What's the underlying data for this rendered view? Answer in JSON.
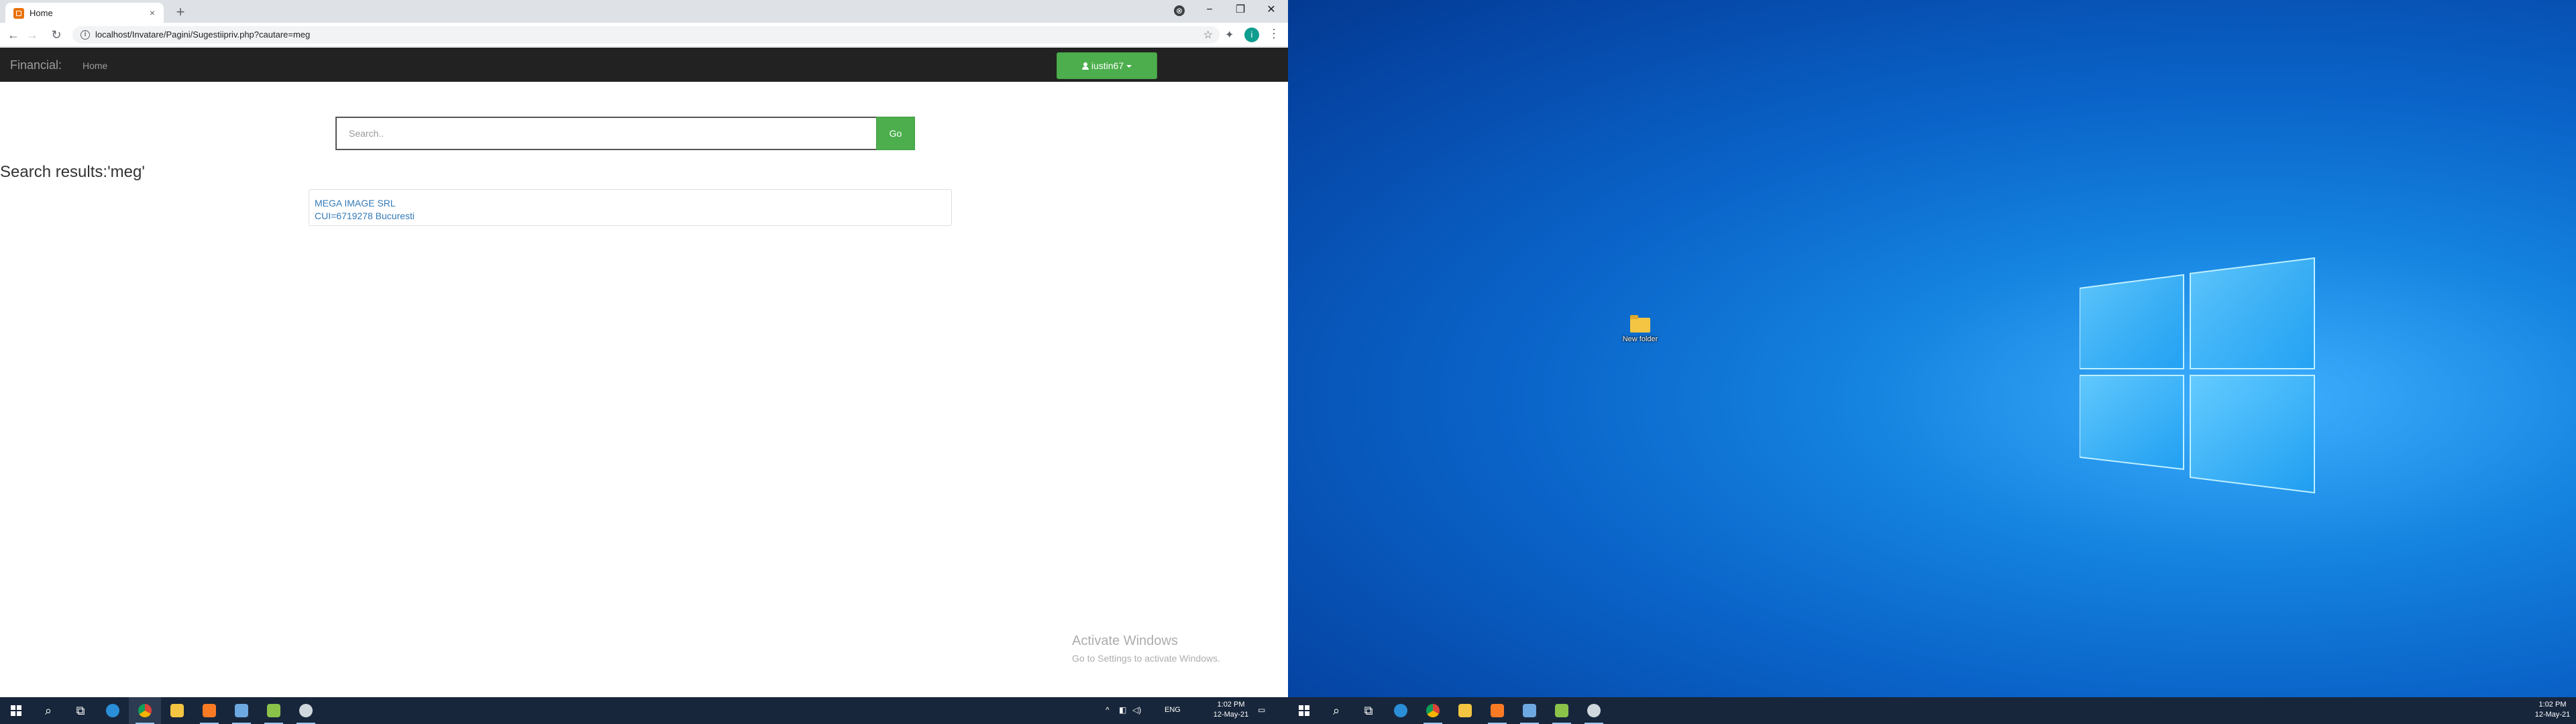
{
  "browser": {
    "tab_title": "Home",
    "tab_close": "×",
    "new_tab": "+",
    "url": "localhost/Invatare/Pagini/Sugestiipriv.php?cautare=meg",
    "window_controls": {
      "minimize": "−",
      "maximize": "❐",
      "close": "✕"
    },
    "profile_initial": "i"
  },
  "navbar": {
    "brand": "Financial:",
    "home": "Home",
    "user_label": "iustin67"
  },
  "search": {
    "placeholder": "Search..",
    "button": "Go"
  },
  "results": {
    "title": "Search results:'meg'",
    "items": [
      {
        "name": "MEGA IMAGE SRL",
        "info": "CUI=6719278 Bucuresti"
      }
    ]
  },
  "watermark": {
    "line1": "Activate Windows",
    "line2": "Go to Settings to activate Windows."
  },
  "taskbar_left": {
    "language": "ENG",
    "time": "1:02 PM",
    "date": "12-May-21"
  },
  "taskbar_right": {
    "time": "1:02 PM",
    "date": "12-May-21"
  },
  "desktop": {
    "icon_label": "New folder"
  },
  "icons": {
    "start": "windows-logo-icon",
    "search": "search-icon",
    "task_view": "task-view-icon",
    "edge": "edge-icon",
    "chrome": "chrome-icon",
    "explorer": "folder-icon",
    "xampp": "xampp-icon",
    "virtualbox": "virtualbox-icon",
    "notepad": "notepad-icon",
    "settings_app": "gear-app-icon"
  }
}
